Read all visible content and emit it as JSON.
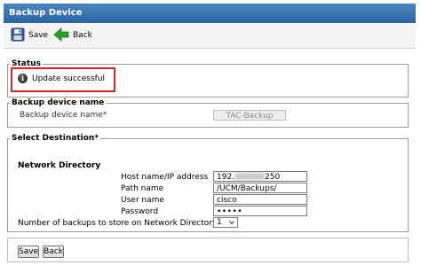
{
  "window": {
    "title": "Backup Device"
  },
  "toolbar": {
    "save_label": "Save",
    "back_label": "Back"
  },
  "status": {
    "legend": "Status",
    "message": "Update successful",
    "icon": "info-icon"
  },
  "backup_device": {
    "legend": "Backup device name",
    "label": "Backup device name*",
    "value": "TAC-Backup"
  },
  "destination": {
    "legend": "Select Destination*",
    "heading": "Network Directory",
    "host_label": "Host name/IP address",
    "host_prefix": "192.",
    "host_suffix": "250",
    "path_label": "Path name",
    "path_value": "/UCM/Backups/",
    "user_label": "User name",
    "user_value": "cisco",
    "password_label": "Password",
    "password_value": "•••••",
    "backups_label": "Number of backups to store on Network Directory",
    "backups_value": "1"
  },
  "footer": {
    "save_label": "Save",
    "back_label": "Back"
  },
  "colors": {
    "title_bar": "#2c64a0",
    "highlight": "#d9222a",
    "back_arrow": "#2e9e2e"
  }
}
